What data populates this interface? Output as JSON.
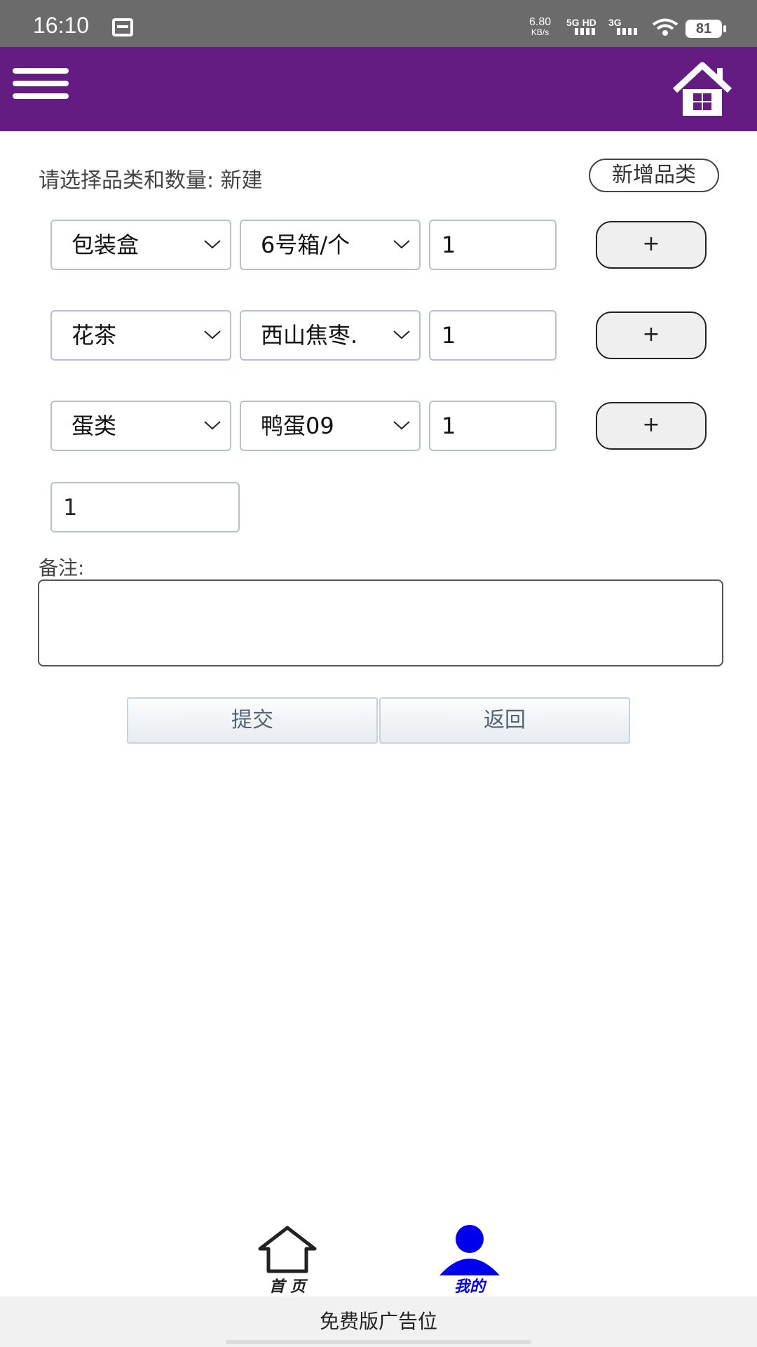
{
  "status_bar": {
    "time": "16:10",
    "speed_value": "6.80",
    "speed_unit": "KB/s",
    "network_1": "5G HD",
    "network_2": "3G",
    "battery": "81"
  },
  "app_bar": {
    "background_color": "#641b82"
  },
  "form": {
    "title": "请选择品类和数量: 新建",
    "add_category_label": "新增品类",
    "rows": [
      {
        "category": "包装盒",
        "item": "6号箱/个",
        "quantity": "1",
        "add_label": "+"
      },
      {
        "category": "花茶",
        "item": "西山焦枣.",
        "quantity": "1",
        "add_label": "+"
      },
      {
        "category": "蛋类",
        "item": "鸭蛋09",
        "quantity": "1",
        "add_label": "+"
      }
    ],
    "extra_quantity": "1",
    "remark_label": "备注:",
    "remark_value": "",
    "submit_label": "提交",
    "back_label": "返回"
  },
  "bottom_nav": {
    "tabs": [
      {
        "label": "首 页",
        "icon": "home-outline-icon",
        "active": false
      },
      {
        "label": "我的",
        "icon": "user-icon",
        "active": true
      }
    ],
    "active_color": "#0000ee"
  },
  "ad_banner": {
    "text": "免费版广告位"
  }
}
